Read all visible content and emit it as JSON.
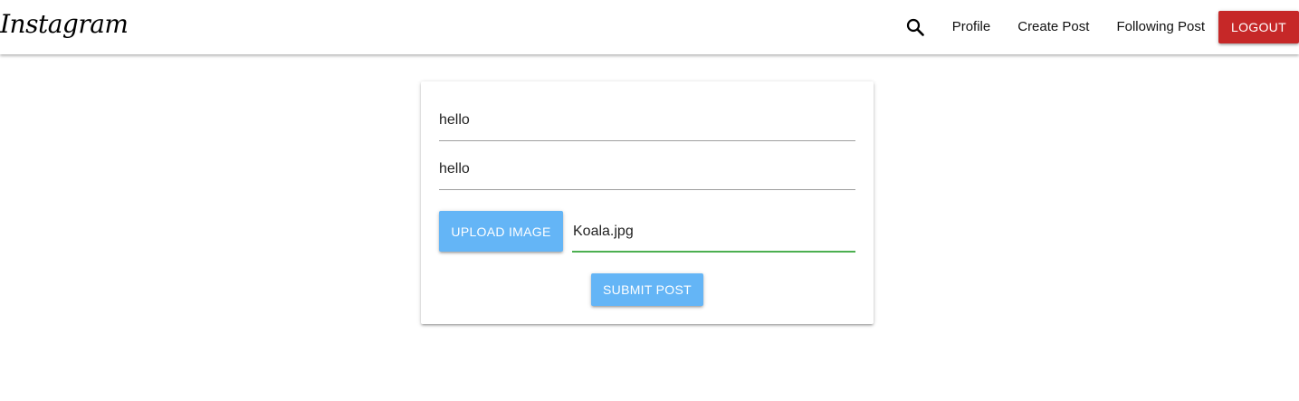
{
  "navbar": {
    "brand": "Instagram",
    "search_icon": "search-icon",
    "links": [
      "Profile",
      "Create Post",
      "Following Post"
    ],
    "logout_label": "LOGOUT",
    "logout_color": "#c62828"
  },
  "create_post": {
    "title_value": "hello",
    "body_value": "hello",
    "upload_label": "UPLOAD IMAGE",
    "file_name": "Koala.jpg",
    "submit_label": "SUBMIT POST",
    "button_color": "#64b5f6",
    "active_field_color": "#4caf50"
  }
}
